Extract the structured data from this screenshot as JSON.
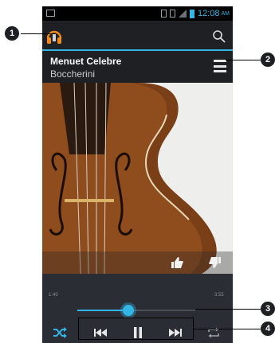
{
  "status_bar": {
    "time": "12:08",
    "ampm": "AM"
  },
  "track": {
    "title": "Menuet Celebre",
    "artist": "Boccherini"
  },
  "player": {
    "elapsed": "1:40",
    "total": "3:55",
    "progress_fraction": 0.43
  },
  "icons": {
    "app": "headphones-icon",
    "search": "search-icon",
    "menu": "menu-icon",
    "like": "thumbs-up-icon",
    "dislike": "thumbs-down-icon",
    "shuffle": "shuffle-icon",
    "previous": "previous-icon",
    "pause": "pause-icon",
    "next": "next-icon",
    "repeat": "repeat-icon"
  },
  "colors": {
    "accent": "#33b5e5",
    "background": "#1f2024",
    "controls_background": "#2a2d33"
  },
  "callouts": [
    "1",
    "2",
    "3",
    "4"
  ]
}
